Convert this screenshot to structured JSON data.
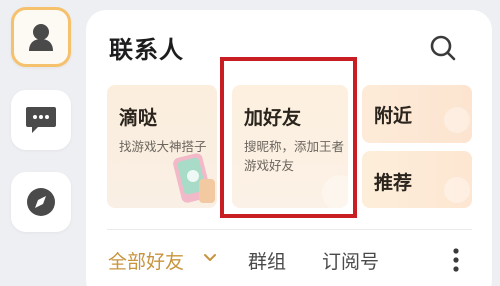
{
  "sidebar": {
    "items": [
      {
        "name": "contacts",
        "icon": "person-icon",
        "active": true
      },
      {
        "name": "messages",
        "icon": "chat-bubble-icon",
        "active": false
      },
      {
        "name": "discover",
        "icon": "compass-icon",
        "active": false
      }
    ]
  },
  "header": {
    "title": "联系人",
    "search_icon": "search-icon"
  },
  "cards": {
    "didi": {
      "title": "滴哒",
      "subtitle": "找游戏大神搭子"
    },
    "add_friend": {
      "title": "加好友",
      "subtitle": "搜昵称，添加王者游戏好友"
    },
    "nearby": {
      "title": "附近"
    },
    "recommend": {
      "title": "推荐"
    }
  },
  "tabs": {
    "all_friends": "全部好友",
    "groups": "群组",
    "subscriptions": "订阅号",
    "more_icon": "more-vertical-icon"
  },
  "colors": {
    "accent": "#c8953f",
    "active_border": "#f6c16c",
    "highlight": "#c81d23",
    "icon_dark": "#4a4a4a"
  }
}
